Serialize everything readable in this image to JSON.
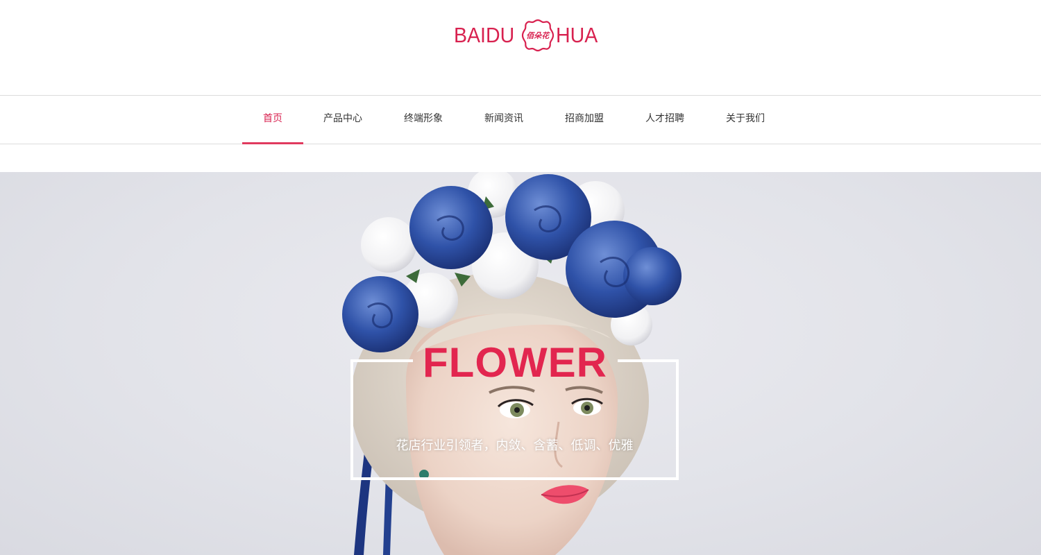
{
  "brand": {
    "logo_left": "BAIDU",
    "logo_badge": "佰朵花",
    "logo_right": "HUA",
    "color": "#d8214f"
  },
  "nav": {
    "items": [
      {
        "label": "首页",
        "active": true
      },
      {
        "label": "产品中心",
        "active": false
      },
      {
        "label": "终端形象",
        "active": false
      },
      {
        "label": "新闻资讯",
        "active": false
      },
      {
        "label": "招商加盟",
        "active": false
      },
      {
        "label": "人才招聘",
        "active": false
      },
      {
        "label": "关于我们",
        "active": false
      }
    ],
    "active_color": "#d8214f"
  },
  "hero": {
    "title": "FLOWER",
    "subtitle": "花店行业引领者，内敛、含蓄、低调、优雅",
    "title_color": "#e2264f",
    "image": "woman-with-blue-rose-crown"
  }
}
